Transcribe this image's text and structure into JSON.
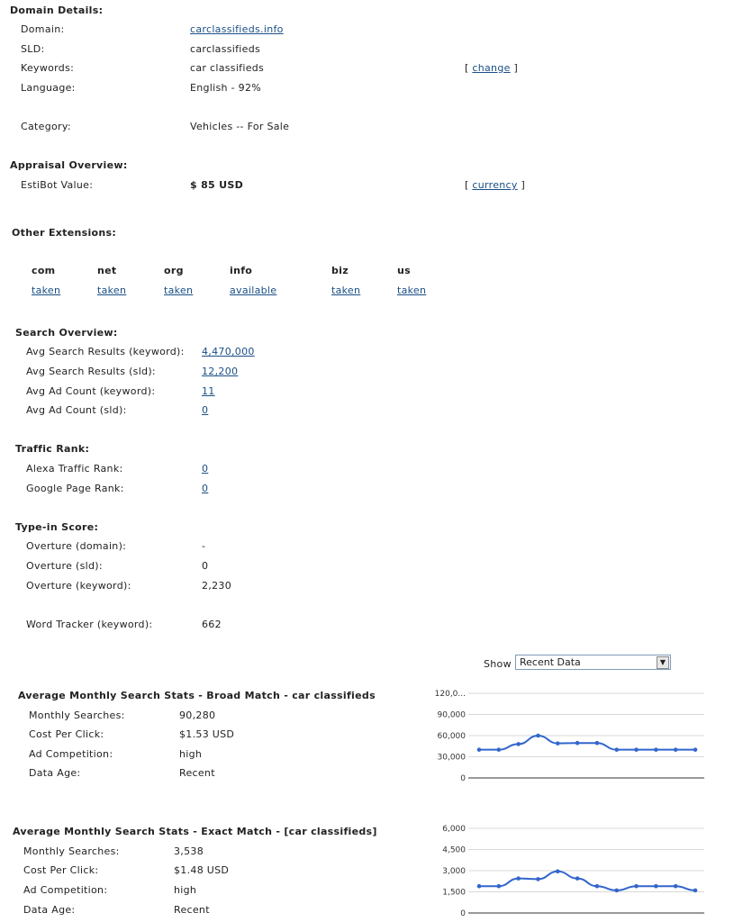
{
  "domain_details": {
    "heading": "Domain Details:",
    "rows": [
      {
        "label": "Domain:",
        "value": "carclassifieds.info"
      },
      {
        "label": "SLD:",
        "value": "carclassifieds"
      },
      {
        "label": "Keywords:",
        "value": "car classifieds",
        "action": "change"
      },
      {
        "label": "Language:",
        "value": "English - 92%"
      },
      {
        "label": "Category:",
        "value": "Vehicles -- For Sale"
      }
    ]
  },
  "appraisal": {
    "heading": "Appraisal Overview:",
    "label": "EstiBot Value:",
    "value": "$ 85 USD",
    "action": "currency"
  },
  "other_extensions": {
    "heading": "Other Extensions:",
    "items": [
      {
        "ext": "com",
        "status": "taken"
      },
      {
        "ext": "net",
        "status": "taken"
      },
      {
        "ext": "org",
        "status": "taken"
      },
      {
        "ext": "info",
        "status": "available"
      },
      {
        "ext": "biz",
        "status": "taken"
      },
      {
        "ext": "us",
        "status": "taken"
      }
    ]
  },
  "search_overview": {
    "heading": "Search Overview:",
    "rows": [
      {
        "label": "Avg Search Results (keyword):",
        "value": "4,470,000"
      },
      {
        "label": "Avg Search Results (sld):",
        "value": "12,200"
      },
      {
        "label": "Avg Ad Count (keyword):",
        "value": "11"
      },
      {
        "label": "Avg Ad Count (sld):",
        "value": "0"
      }
    ]
  },
  "traffic_rank": {
    "heading": "Traffic Rank:",
    "rows": [
      {
        "label": "Alexa Traffic Rank:",
        "value": "0"
      },
      {
        "label": "Google Page Rank:",
        "value": "0"
      }
    ]
  },
  "type_in": {
    "heading": "Type-in Score:",
    "rows": [
      {
        "label": "Overture (domain):",
        "value": "-"
      },
      {
        "label": "Overture (sld):",
        "value": "0"
      },
      {
        "label": "Overture (keyword):",
        "value": "2,230"
      },
      {
        "label": "Word Tracker (keyword):",
        "value": "662"
      }
    ]
  },
  "show": {
    "label": "Show",
    "selected": "Recent Data"
  },
  "broad": {
    "heading": "Average Monthly Search Stats - Broad Match - car classifieds",
    "rows": [
      {
        "label": "Monthly Searches:",
        "value": "90,280"
      },
      {
        "label": "Cost Per Click:",
        "value": "$1.53 USD"
      },
      {
        "label": "Ad Competition:",
        "value": "high"
      },
      {
        "label": "Data Age:",
        "value": "Recent"
      }
    ]
  },
  "exact": {
    "heading": "Average Monthly Search Stats - Exact Match - [car classifieds]",
    "rows": [
      {
        "label": "Monthly Searches:",
        "value": "3,538"
      },
      {
        "label": "Cost Per Click:",
        "value": "$1.48 USD"
      },
      {
        "label": "Ad Competition:",
        "value": "high"
      },
      {
        "label": "Data Age:",
        "value": "Recent"
      }
    ]
  },
  "chart_data": [
    {
      "type": "line",
      "ylim": [
        0,
        120000
      ],
      "yticks": [
        "120,0...",
        "90,000",
        "60,000",
        "30,000",
        "0"
      ],
      "color": "#3366cc",
      "values": [
        40000,
        40000,
        48000,
        60000,
        49000,
        49500,
        49500,
        40000,
        40000,
        40000,
        40000,
        40000
      ]
    },
    {
      "type": "line",
      "ylim": [
        0,
        6000
      ],
      "yticks": [
        "6,000",
        "4,500",
        "3,000",
        "1,500",
        "0"
      ],
      "color": "#3366cc",
      "values": [
        1900,
        1900,
        2450,
        2400,
        2950,
        2450,
        1900,
        1600,
        1900,
        1900,
        1900,
        1600
      ]
    }
  ]
}
